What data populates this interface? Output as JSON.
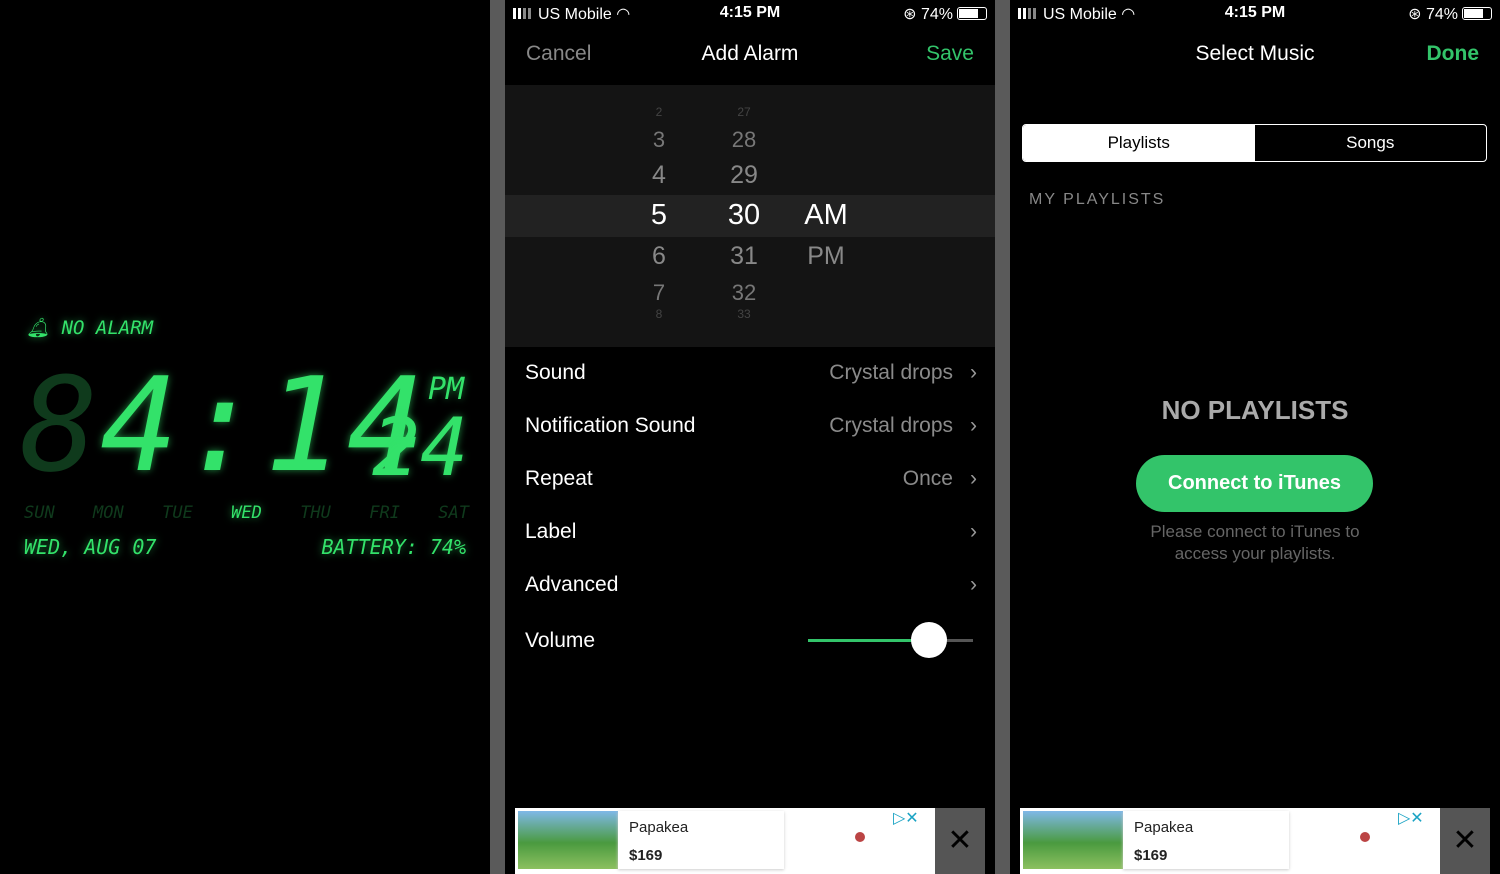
{
  "clock": {
    "alarm": "NO ALARM",
    "hour_ghost": "8",
    "time": "4:14",
    "ampm": "PM",
    "seconds": "24",
    "days": [
      "SUN",
      "MON",
      "TUE",
      "WED",
      "THU",
      "FRI",
      "SAT"
    ],
    "active_day": "WED",
    "date": "WED, AUG 07",
    "battery": "BATTERY: 74%",
    "color": "#33e26a"
  },
  "status": {
    "carrier": "US Mobile",
    "time": "4:15 PM",
    "battery": "74%"
  },
  "add_alarm": {
    "cancel": "Cancel",
    "title": "Add Alarm",
    "save": "Save",
    "picker": {
      "hours": [
        "2",
        "3",
        "4",
        "5",
        "6",
        "7",
        "8"
      ],
      "minutes": [
        "27",
        "28",
        "29",
        "30",
        "31",
        "32",
        "33"
      ],
      "periods": [
        "AM",
        "PM"
      ],
      "selected": {
        "hour": "5",
        "minute": "30",
        "period": "AM"
      }
    },
    "rows": [
      {
        "label": "Sound",
        "value": "Crystal drops"
      },
      {
        "label": "Notification Sound",
        "value": "Crystal drops"
      },
      {
        "label": "Repeat",
        "value": "Once"
      },
      {
        "label": "Label",
        "value": ""
      },
      {
        "label": "Advanced",
        "value": ""
      }
    ],
    "volume": {
      "label": "Volume",
      "level": 0.74
    }
  },
  "select_music": {
    "title": "Select Music",
    "done": "Done",
    "tabs": [
      "Playlists",
      "Songs"
    ],
    "active_tab": "Playlists",
    "section": "MY PLAYLISTS",
    "empty_title": "NO PLAYLISTS",
    "connect": "Connect to iTunes",
    "hint_line1": "Please connect to iTunes to",
    "hint_line2": "access your playlists."
  },
  "ad": {
    "title": "Papakea",
    "price": "$169",
    "close": "✕",
    "adchoices": "▷✕"
  },
  "accent": "#33c46a"
}
